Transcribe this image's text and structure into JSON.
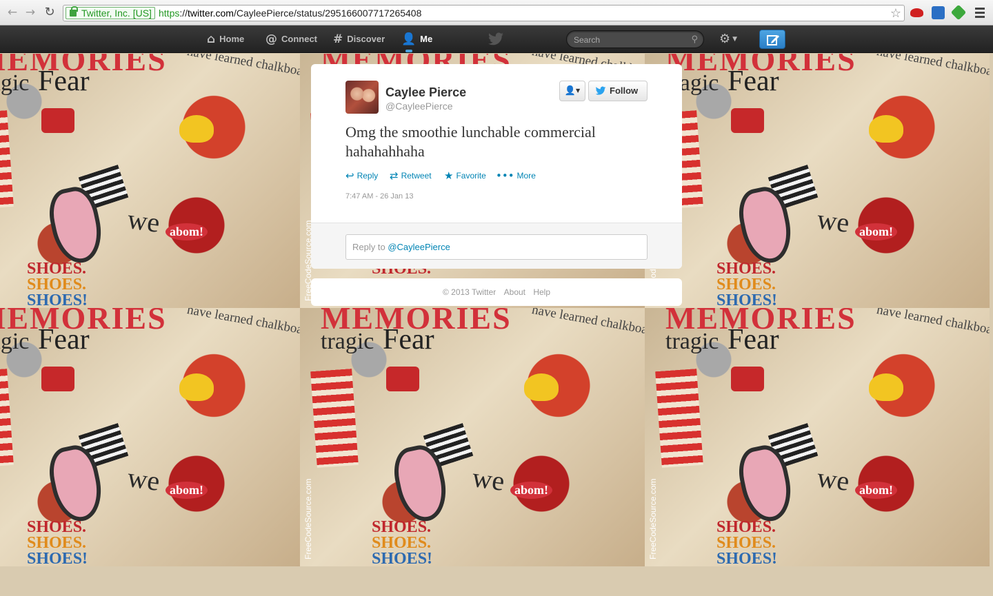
{
  "browser": {
    "ev_label": "Twitter, Inc. [US]",
    "url_scheme": "https",
    "url_sep": "://",
    "url_host": "twitter.com",
    "url_path": "/CayleePierce/status/295166007717265408"
  },
  "nav": {
    "home": "Home",
    "connect": "Connect",
    "discover": "Discover",
    "me": "Me",
    "search_placeholder": "Search"
  },
  "tweet": {
    "fullname": "Caylee Pierce",
    "screenname": "@CayleePierce",
    "follow_label": "Follow",
    "text": "Omg the smoothie lunchable commercial hahahahhaha",
    "actions": {
      "reply": "Reply",
      "retweet": "Retweet",
      "favorite": "Favorite",
      "more": "More"
    },
    "timestamp": "7:47 AM - 26 Jan 13",
    "reply_prompt": "Reply to ",
    "reply_mention": "@CayleePierce"
  },
  "footer": {
    "copyright": "© 2013 Twitter",
    "about": "About",
    "help": "Help"
  },
  "background": {
    "memories": "MEMORIES",
    "tragic": "tragic",
    "fear": "Fear",
    "shoes": "SHOES.",
    "shoes_last": "SHOES!",
    "we": "we",
    "abom": "abom!",
    "learned": "have learned chalkboard",
    "watermark": "FreeCodeSource.com"
  },
  "colors": {
    "link": "#0084b4",
    "topbar": "#222222",
    "compose": "#2a7ec6",
    "ev_green": "#239823"
  }
}
